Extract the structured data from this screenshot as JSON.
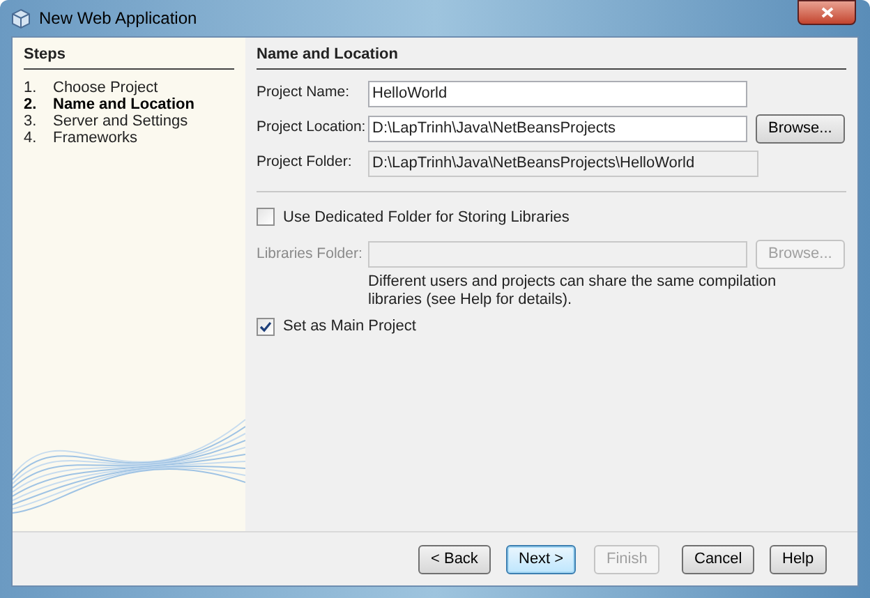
{
  "window": {
    "title": "New Web Application"
  },
  "steps": {
    "title": "Steps",
    "items": [
      {
        "number": "1.",
        "label": "Choose Project",
        "selected": false
      },
      {
        "number": "2.",
        "label": "Name and Location",
        "selected": true
      },
      {
        "number": "3.",
        "label": "Server and Settings",
        "selected": false
      },
      {
        "number": "4.",
        "label": "Frameworks",
        "selected": false
      }
    ]
  },
  "panel": {
    "title": "Name and Location",
    "fields": [
      {
        "label": "Project Name:",
        "value": "HelloWorld",
        "editable": true
      },
      {
        "label": "Project Location:",
        "value": "D:\\LapTrinh\\Java\\NetBeansProjects",
        "editable": true,
        "button": "Browse..."
      },
      {
        "label": "Project Folder:",
        "value": "D:\\LapTrinh\\Java\\NetBeansProjects\\HelloWorld",
        "editable": false
      }
    ],
    "libraries_checkbox": {
      "label": "Use Dedicated Folder for Storing Libraries",
      "checked": false
    },
    "libraries_field": {
      "label": "Libraries Folder:",
      "disabled": true,
      "button": "Browse..."
    },
    "libraries_note": "Different users and projects can share the same compilation libraries (see Help for details).",
    "main_project_checkbox": {
      "label": "Set as Main Project",
      "checked": true
    }
  },
  "buttons": [
    {
      "label": "< Back",
      "disabled": false,
      "default": false
    },
    {
      "label": "Next >",
      "disabled": false,
      "default": true
    },
    {
      "label": "Finish",
      "disabled": true,
      "default": false
    },
    {
      "label": "Cancel",
      "disabled": false,
      "default": false
    },
    {
      "label": "Help",
      "disabled": false,
      "default": false
    }
  ]
}
